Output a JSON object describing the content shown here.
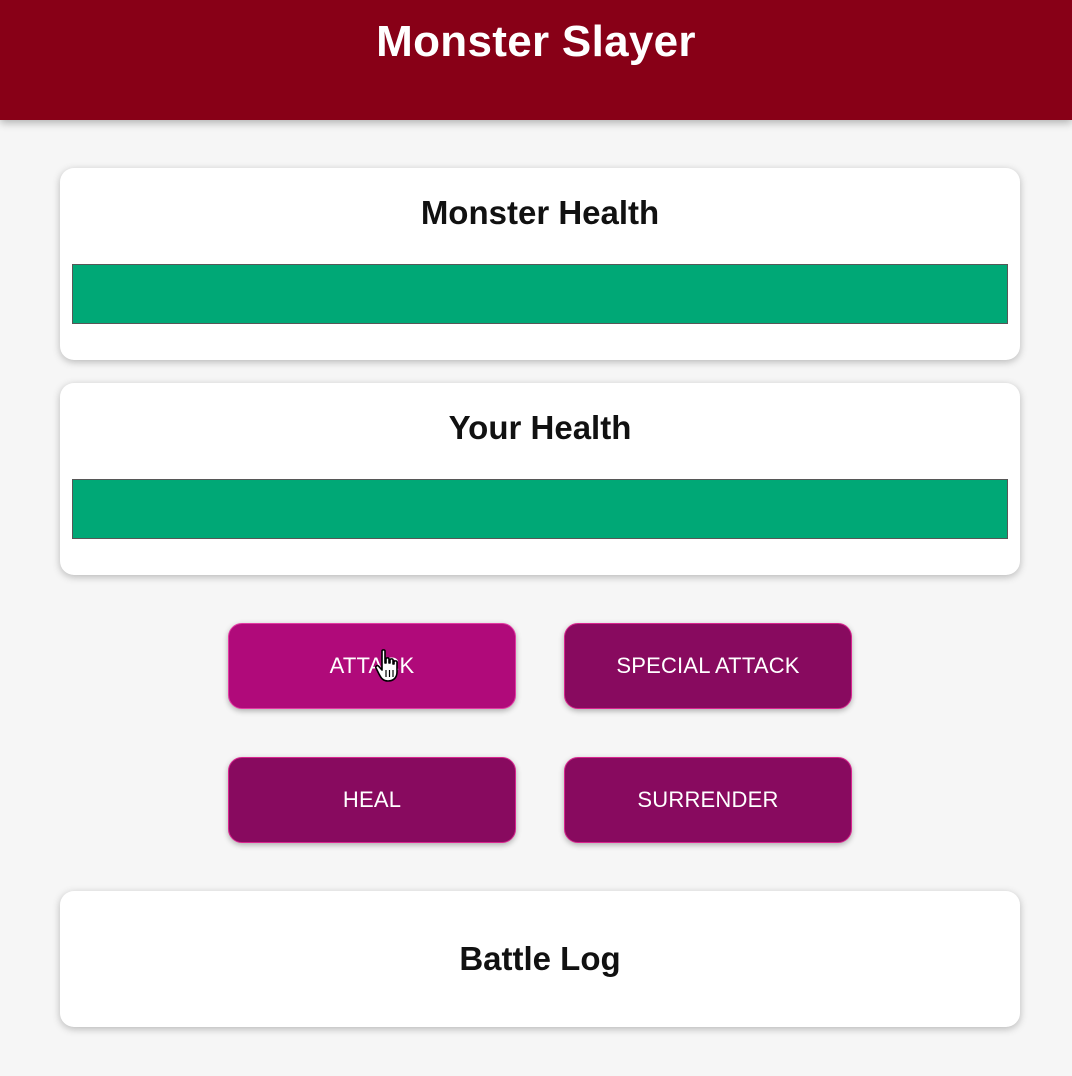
{
  "header": {
    "title": "Monster Slayer"
  },
  "monster": {
    "title": "Monster Health",
    "health_percent": 100
  },
  "player": {
    "title": "Your Health",
    "health_percent": 100
  },
  "controls": {
    "attack_label": "ATTACK",
    "special_attack_label": "SPECIAL ATTACK",
    "heal_label": "HEAL",
    "surrender_label": "SURRENDER"
  },
  "log": {
    "title": "Battle Log"
  },
  "colors": {
    "header": "#880017",
    "health_bar": "#00a876",
    "button": "#880a5f",
    "button_hover": "#b00a7a"
  },
  "icons": {
    "cursor": "hand-pointer-icon"
  }
}
